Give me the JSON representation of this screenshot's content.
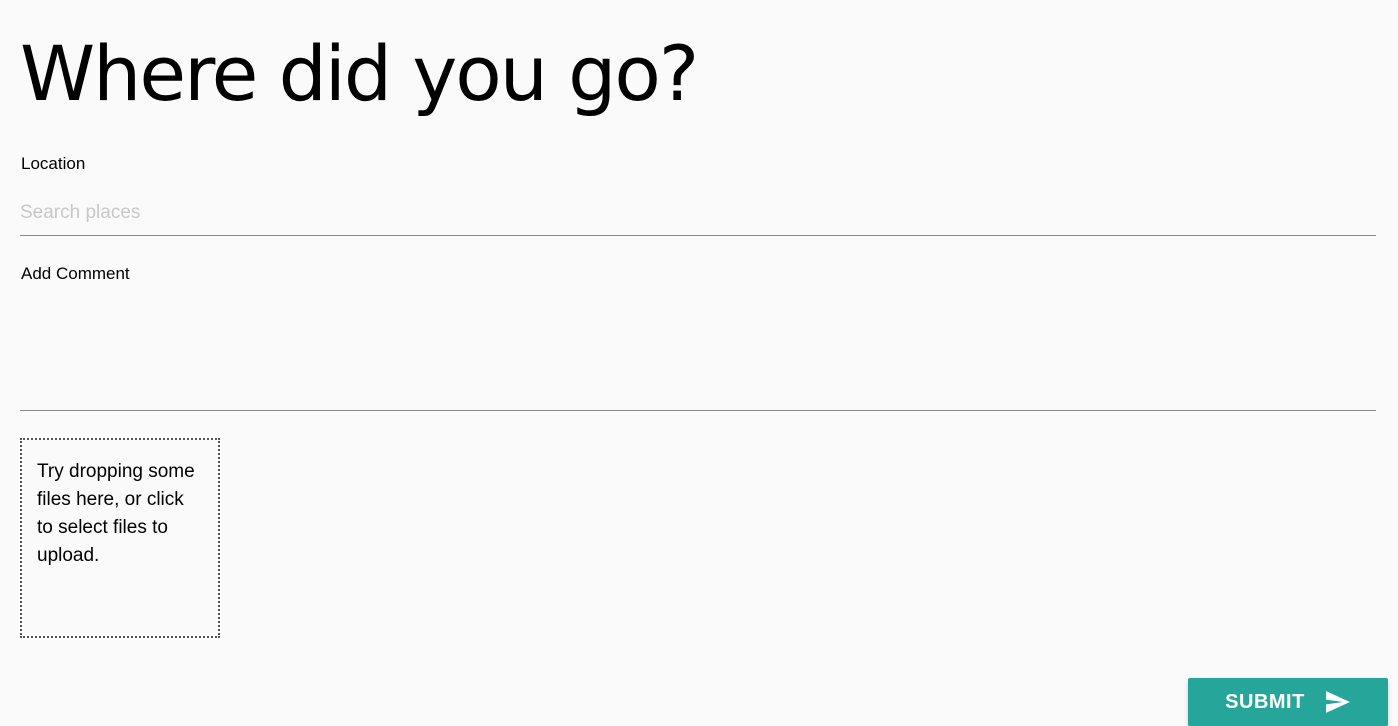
{
  "page": {
    "title": "Where did you go?"
  },
  "location": {
    "label": "Location",
    "placeholder": "Search places",
    "value": ""
  },
  "comment": {
    "label": "Add Comment",
    "value": ""
  },
  "dropzone": {
    "text": "Try dropping some files here, or click to select files to upload."
  },
  "submit": {
    "label": "SUBMIT",
    "icon": "send-icon",
    "color": "#26a69a"
  },
  "colors": {
    "background": "#fafafa",
    "accent": "#26a69a",
    "placeholder": "#c8c8c8",
    "underline": "#8a8a8a"
  }
}
